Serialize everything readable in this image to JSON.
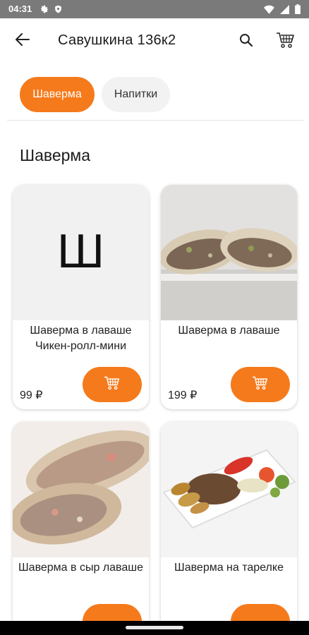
{
  "status_bar": {
    "time": "04:31",
    "left_icons": [
      "gear-icon",
      "shield-icon"
    ],
    "right_icons": [
      "wifi-icon",
      "signal-icon",
      "battery-icon"
    ]
  },
  "app_bar": {
    "title": "Савушкина 136к2",
    "back_icon": "arrow-back-icon",
    "search_icon": "search-icon",
    "cart_icon": "cart-icon"
  },
  "categories": [
    {
      "label": "Шаверма",
      "active": true
    },
    {
      "label": "Напитки",
      "active": false
    }
  ],
  "section": {
    "title": "Шаверма"
  },
  "products": [
    {
      "name": "Шаверма в лаваше Чикен-ролл-мини",
      "price": "99 ₽",
      "image_letter": "Ш"
    },
    {
      "name": "Шаверма в лаваше",
      "price": "199 ₽"
    },
    {
      "name": "Шаверма в сыр лаваше",
      "price": ""
    },
    {
      "name": "Шаверма на тарелке",
      "price": ""
    }
  ],
  "colors": {
    "accent": "#f57a1c",
    "status_bar": "#7a7a7a",
    "chip_idle": "#f2f2f2"
  }
}
